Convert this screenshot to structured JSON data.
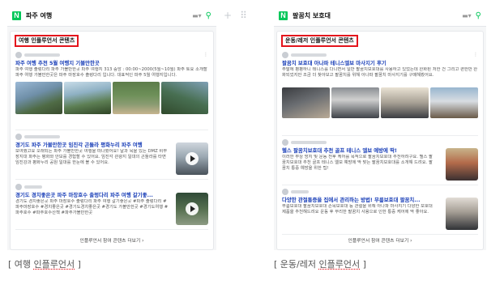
{
  "left": {
    "query": "파주 여행",
    "section_title": "여행 인플루언서 콘텐츠",
    "entries": [
      {
        "title": "파주 여행 추천 5월 여행지 기볼만한곳",
        "body": "파주 여행 출렁다리 파주 가볼만한곳 파주 여행지 313 중앙 : 00:00~2000(5월~10월) 파주 토요 소개할 파주 여행 가볼만한곳은 파주 마장호수 출렁다리 입니다. 대표적인 파주 5월 여행지입니다."
      },
      {
        "title": "경기도 파주 가볼만한곳 임진각 곤돌라 평화누리 파주 여행",
        "body": "보여했고요 오래되는 파주 가볼만한곳 여행을 떠나봤어요! 날과 목을 있는 DMZ 비무장지대 파주는 평화와 안보를 경험할 수 있어요. 임진각 관광지 일대의 곤돌라를 타면 임진강과 평화누리 공원 일대를 한눈에 볼 수 있어요."
      },
      {
        "title": "경기도 경치좋은곳 파주 마장호수 출렁다리 파주 여행 갈기좋...",
        "body": "경기도 경치좋은곳 파주 마장호수 출렁다리 파주 여행 갈기좋은곳 #파주 출렁다리 #파주마장호수 #경치좋은곳 #경기도경치좋은곳 #경기도 가볼만한곳 #경기도여행 #파주호수 #파주호수산책 #파주가볼만한곳"
      }
    ],
    "more_link": "인플루언서 참여 콘텐츠 더보기 ›"
  },
  "right": {
    "query": "팔꿈치 보호대",
    "section_title": "운동/레저 인플루언서 콘텐츠",
    "entries": [
      {
        "title": "팔꿈치 보호대 아나파 테니스엘보 마사지기 후기",
        "body": "주말에 평평하니 테니스를 다니면서 일반 팔꿈치보호대를 사용하고 있었는데 완화된 저한 건 그리고 편한만 완화되었지만 조금 더 찾아보고 팔꿈치를 위해 아나파 팔꿈치 마사지기를 구매해봤어요."
      },
      {
        "title": "헬스 팔꿈치보호대 추천 골프 테니스 엘보 예방에 딱!",
        "body": "이러한 부상 방지 및 운동 전후 케어를 목적으로 팔꿈치보호대 추천하려구요. 헬스 팔꿈치보호대 추천 골프 테니스 엘보 예방에 딱 맞는 팔꿈치보호대를 소개해 드려요. 팔꿈치 통증 예방을 위한 팁!"
      },
      {
        "title": "다양한 관절통증을 집에서 관리하는 방법! 무릎보호대 팔꿈치...",
        "body": "무릎보호대 팔꿈치보호대 손목보호대 등 관절을 위해 아나파 마사지기 다양한 보호대 제품을 추천해드려요 운동 후 무리한 팔꿈치 사용으로 인한 통증 케어에 딱 좋아요."
      }
    ],
    "more_link": "인플루언서 참여 콘텐츠 더보기 ›"
  },
  "captions": {
    "left_prefix": "[ 여행 ",
    "left_word": "인플루언서",
    "left_suffix": " ]",
    "right_prefix": "[ 운동/레저 ",
    "right_word": "인플루언서",
    "right_suffix": " ]"
  },
  "icons": {
    "brand": "naver-n-logo",
    "search": "search-icon",
    "keyboard": "keyboard-icon",
    "more": "more-dots-icon",
    "play": "play-icon",
    "add": "plus-icon",
    "grid": "grid-icon"
  },
  "colors": {
    "brand": "#03c75a",
    "highlight": "#e4141c",
    "link": "#1a3fb8"
  }
}
